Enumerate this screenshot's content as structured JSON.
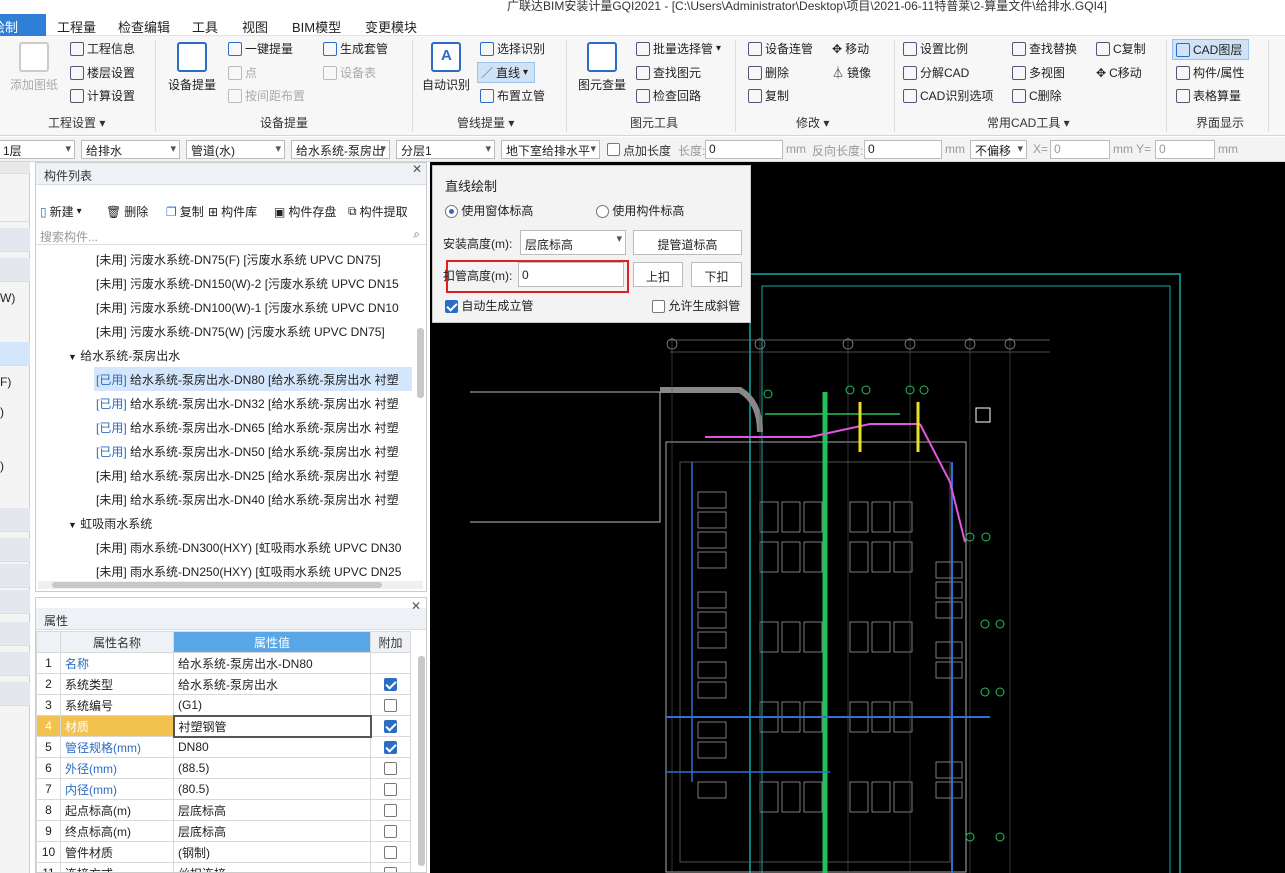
{
  "app": {
    "title": "广联达BIM安装计量GQI2021 - [C:\\Users\\Administrator\\Desktop\\项目\\2021-06-11特普莱\\2-算量文件\\给排水.GQI4]"
  },
  "menu": {
    "active": "绘制",
    "items": [
      "工程量",
      "检查编辑",
      "工具",
      "视图",
      "BIM模型",
      "变更模块"
    ]
  },
  "ribbon": {
    "g1": {
      "big": "添加图纸",
      "items": [
        "工程信息",
        "楼层设置",
        "计算设置"
      ],
      "label": "工程设置 ▾"
    },
    "g2": {
      "big": "设备提量",
      "items": [
        "一键提量",
        "点",
        "按间距布置",
        "生成套管",
        "设备表"
      ],
      "label": "设备提量"
    },
    "g3": {
      "big": "自动识别",
      "items": [
        "选择识别",
        "直线",
        "布置立管"
      ],
      "label": "管线提量 ▾"
    },
    "g4": {
      "big": "图元查量",
      "items": [
        "批量选择管",
        "查找图元",
        "检查回路"
      ],
      "label": "图元工具"
    },
    "g5": {
      "items": [
        "设备连管",
        "删除",
        "复制",
        "移动",
        "镜像"
      ],
      "label": "修改 ▾"
    },
    "g6": {
      "items": [
        "设置比例",
        "分解CAD",
        "CAD识别选项",
        "查找替换",
        "多视图",
        "C删除",
        "C复制",
        "C移动"
      ],
      "label": "常用CAD工具 ▾"
    },
    "g7": {
      "items": [
        "CAD图层",
        "构件/属性",
        "表格算量"
      ],
      "label": "界面显示"
    }
  },
  "toolbar": {
    "floor": "1层",
    "discipline": "给排水",
    "type": "管道(水)",
    "system": "给水系统-泵房出",
    "layer": "分层1",
    "pipe": "地下室给排水平",
    "add_len": "点加长度",
    "len_label": "长度:",
    "len_val": "0",
    "unit": "mm",
    "rev_label": "反向长度:",
    "rev_val": "0",
    "unit2": "mm",
    "offset": "不偏移",
    "x_label": "X=",
    "x_val": "0",
    "y_label": "mm Y=",
    "y_val": "0",
    "unit3": "mm"
  },
  "leftstrip": [
    "W)",
    "F)",
    ")",
    ")"
  ],
  "complist": {
    "title": "构件列表",
    "actions": [
      "新建",
      "删除",
      "复制",
      "构件库",
      "构件存盘",
      "构件提取"
    ],
    "search": "搜索构件...",
    "rows": [
      {
        "tag": "[未用]",
        "text": "污废水系统-DN75(F) [污废水系统 UPVC DN75]"
      },
      {
        "tag": "[未用]",
        "text": "污废水系统-DN150(W)-2 [污废水系统 UPVC DN15"
      },
      {
        "tag": "[未用]",
        "text": "污废水系统-DN100(W)-1 [污废水系统 UPVC DN10"
      },
      {
        "tag": "[未用]",
        "text": "污废水系统-DN75(W) [污废水系统 UPVC DN75]"
      },
      {
        "group": "给水系统-泵房出水"
      },
      {
        "tag": "[已用]",
        "text": "给水系统-泵房出水-DN80 [给水系统-泵房出水 衬塑"
      },
      {
        "tag": "[已用]",
        "text": "给水系统-泵房出水-DN32 [给水系统-泵房出水 衬塑"
      },
      {
        "tag": "[已用]",
        "text": "给水系统-泵房出水-DN65 [给水系统-泵房出水 衬塑"
      },
      {
        "tag": "[已用]",
        "text": "给水系统-泵房出水-DN50 [给水系统-泵房出水 衬塑"
      },
      {
        "tag": "[未用]",
        "text": "给水系统-泵房出水-DN25 [给水系统-泵房出水 衬塑"
      },
      {
        "tag": "[未用]",
        "text": "给水系统-泵房出水-DN40 [给水系统-泵房出水 衬塑"
      },
      {
        "group": "虹吸雨水系统"
      },
      {
        "tag": "[未用]",
        "text": "雨水系统-DN300(HXY) [虹吸雨水系统 UPVC DN30"
      },
      {
        "tag": "[未用]",
        "text": "雨水系统-DN250(HXY) [虹吸雨水系统 UPVC DN25"
      }
    ]
  },
  "props": {
    "title": "属性",
    "headers": [
      "属性名称",
      "属性值",
      "附加"
    ],
    "rows": [
      {
        "i": "1",
        "name": "名称",
        "value": "给水系统-泵房出水-DN80",
        "blue": true,
        "cb": null
      },
      {
        "i": "2",
        "name": "系统类型",
        "value": "给水系统-泵房出水",
        "blue": false,
        "cb": true
      },
      {
        "i": "3",
        "name": "系统编号",
        "value": "(G1)",
        "blue": false,
        "cb": false
      },
      {
        "i": "4",
        "name": "材质",
        "value": "衬塑钢管",
        "blue": true,
        "cb": true
      },
      {
        "i": "5",
        "name": "管径规格(mm)",
        "value": "DN80",
        "blue": true,
        "cb": true
      },
      {
        "i": "6",
        "name": "外径(mm)",
        "value": "(88.5)",
        "blue": true,
        "cb": false
      },
      {
        "i": "7",
        "name": "内径(mm)",
        "value": "(80.5)",
        "blue": true,
        "cb": false
      },
      {
        "i": "8",
        "name": "起点标高(m)",
        "value": "层底标高",
        "blue": false,
        "cb": false
      },
      {
        "i": "9",
        "name": "终点标高(m)",
        "value": "层底标高",
        "blue": false,
        "cb": false
      },
      {
        "i": "10",
        "name": "管件材质",
        "value": "(钢制)",
        "blue": false,
        "cb": false
      },
      {
        "i": "11",
        "name": "连接方式",
        "value": "丝扣连接",
        "blue": false,
        "cb": false
      }
    ]
  },
  "dialog": {
    "title": "直线绘制",
    "radio1": "使用窗体标高",
    "radio2": "使用构件标高",
    "install_label": "安装高度(m):",
    "install_value": "层底标高",
    "lift_btn": "提管道标高",
    "buckle_label": "扣管高度(m):",
    "buckle_value": "0",
    "up": "上扣",
    "down": "下扣",
    "auto_riser": "自动生成立管",
    "allow_slope": "允许生成斜管"
  },
  "colors": {
    "accent": "#2f7fd6",
    "highlight": "#e02020",
    "canvas": "#000000"
  }
}
